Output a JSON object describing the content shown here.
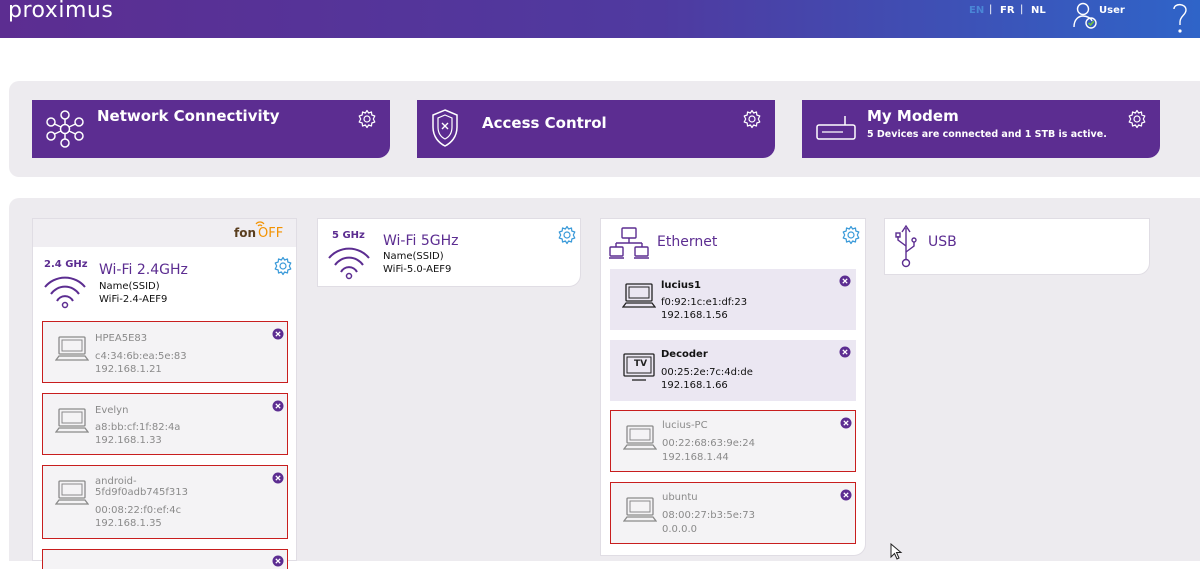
{
  "brand": {
    "logo_text": "proximus",
    "primary_color": "#5c2d91"
  },
  "header": {
    "languages": [
      {
        "code": "EN",
        "active": true
      },
      {
        "code": "FR",
        "active": false
      },
      {
        "code": "NL",
        "active": false
      }
    ],
    "separator": "|",
    "user_label": "User",
    "icons": {
      "user": "user-check-icon",
      "help": "help-icon"
    }
  },
  "tiles": [
    {
      "title": "Network Connectivity",
      "subtitle": "",
      "icon": "network-hub-icon",
      "settings_icon": "gear-icon"
    },
    {
      "title": "Access Control",
      "subtitle": "",
      "icon": "shield-icon",
      "settings_icon": "gear-icon"
    },
    {
      "title": "My Modem",
      "subtitle": "5 Devices are connected and 1 STB is active.",
      "icon": "modem-icon",
      "settings_icon": "gear-icon"
    }
  ],
  "wifi24": {
    "fon_brand": "fon",
    "fon_status": "OFF",
    "band": "2.4 GHz",
    "title": "Wi-Fi 2.4GHz",
    "ssid_label": "Name(SSID)",
    "ssid": "WiFi-2.4-AEF9",
    "devices": [
      {
        "name": "HPEA5E83",
        "mac": "c4:34:6b:ea:5e:83",
        "ip": "192.168.1.21",
        "active": false
      },
      {
        "name": "Evelyn",
        "mac": "a8:bb:cf:1f:82:4a",
        "ip": "192.168.1.33",
        "active": false
      },
      {
        "name": "android-\n5fd9f0adb745f313",
        "mac": "00:08:22:f0:ef:4c",
        "ip": "192.168.1.35",
        "active": false
      }
    ]
  },
  "wifi5": {
    "band": "5 GHz",
    "title": "Wi-Fi 5GHz",
    "ssid_label": "Name(SSID)",
    "ssid": "WiFi-5.0-AEF9"
  },
  "ethernet": {
    "title": "Ethernet",
    "devices": [
      {
        "name": "lucius1",
        "mac": "f0:92:1c:e1:df:23",
        "ip": "192.168.1.56",
        "active": true,
        "type": "laptop"
      },
      {
        "name": "Decoder",
        "mac": "00:25:2e:7c:4d:de",
        "ip": "192.168.1.66",
        "active": true,
        "type": "tv",
        "tv_label": "TV"
      },
      {
        "name": "lucius-PC",
        "mac": "00:22:68:63:9e:24",
        "ip": "192.168.1.44",
        "active": false,
        "type": "laptop"
      },
      {
        "name": "ubuntu",
        "mac": "08:00:27:b3:5e:73",
        "ip": "0.0.0.0",
        "active": false,
        "type": "laptop"
      }
    ]
  },
  "usb": {
    "title": "USB",
    "icon": "usb-icon"
  },
  "colors": {
    "inactive_border": "#c81e1e",
    "active_bg": "#ebe7f2",
    "fon_off": "#f39200"
  }
}
